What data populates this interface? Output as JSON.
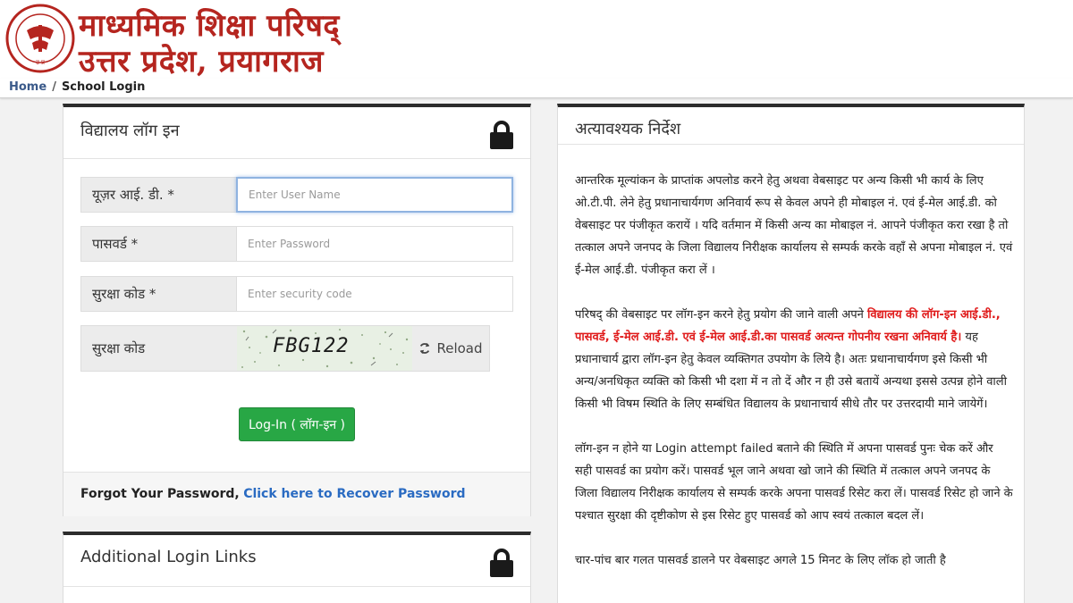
{
  "header": {
    "title_line1": "माध्यमिक शिक्षा परिषद्",
    "title_line2": "उत्तर प्रदेश, प्रयागराज",
    "logo_icon": "up-board-emblem-icon",
    "brand_color": "#b5251f"
  },
  "breadcrumb": {
    "home": "Home",
    "separator": "/",
    "current": "School Login"
  },
  "login_panel": {
    "title": "विद्यालय लॉग इन",
    "lock_icon": "lock-icon",
    "user_label": "यूज़र आई. डी. *",
    "user_placeholder": "Enter User Name",
    "password_label": "पासवर्ड *",
    "password_placeholder": "Enter Password",
    "security_label": "सुरक्षा कोड *",
    "security_placeholder": "Enter security code",
    "captcha_label": "सुरक्षा कोड",
    "captcha_text": "FBG122",
    "reload_label": "Reload",
    "login_button": "Log-In ( लॉग-इन )",
    "forgot_text": "Forgot Your Password,",
    "forgot_link": "Click here to Recover Password"
  },
  "links_panel": {
    "title": "Additional Login Links"
  },
  "instructions": {
    "title": "अत्यावश्यक निर्देश",
    "p1": "आन्तरिक मूल्यांकन के प्राप्तांक अपलोड करने हेतु अथवा वेबसाइट पर अन्य किसी भी कार्य के लिए ओ.टी.पी. लेने हेतु प्रधानाचार्यगण अनिवार्य रूप से केवल अपने ही मोबाइल नं. एवं ई-मेल आई.डी. को वेबसाइट पर पंजीकृत करायें । यदि वर्तमान में किसी अन्य का मोबाइल नं. आपने पंजीकृत करा रखा है तो तत्काल अपने जनपद के जिला विद्यालय निरीक्षक कार्यालय से सम्पर्क करके वहाँ से अपना मोबाइल नं. एवं ई-मेल आई.डी. पंजीकृत करा लें ।",
    "p2_start": "परिषद् की वेबसाइट पर लॉग-इन करने हेतु प्रयोग की जाने वाली अपने",
    "p2_red": "विद्यालय की लॉग-इन आई.डी., पासवर्ड, ई-मेल आई.डी. एवं ई-मेल आई.डी.का पासवर्ड अत्यन्त गोपनीय रखना अनिवार्य है।",
    "p2_end": "यह प्रधानाचार्य द्वारा लॉग-इन हेतु केवल व्यक्तिगत उपयोग के लिये है। अतः प्रधानाचार्यगण इसे किसी भी अन्य/अनधिकृत व्यक्ति को किसी भी दशा में न तो दें और न ही उसे बतायें अन्यथा इससे उत्पन्न होने वाली किसी भी विषम स्थिति के लिए सम्बंधित विद्यालय के प्रधानाचार्य सीधे तौर पर उत्तरदायी माने जायेगें।",
    "p3": "लॉग-इन न होने या Login attempt failed बताने की स्थिति में अपना पासवर्ड पुनः चेक करें और सही पासवर्ड का प्रयोग करें। पासवर्ड भूल जाने अथवा खो जाने की स्थिति में तत्काल अपने जनपद के जिला विद्यालय निरीक्षक कार्यालय से सम्पर्क करके अपना पासवर्ड रिसेट करा लें। पासवर्ड रिसेट हो जाने के पश्चात सुरक्षा की दृष्टीकोण से इस रिसेट हुए पासवर्ड को आप स्वयं तत्काल बदल लें।",
    "p4": "चार-पांच बार गलत पासवर्ड डालने पर वेबसाइट अगले 15 मिनट के लिए लॉक हो जाती है"
  }
}
